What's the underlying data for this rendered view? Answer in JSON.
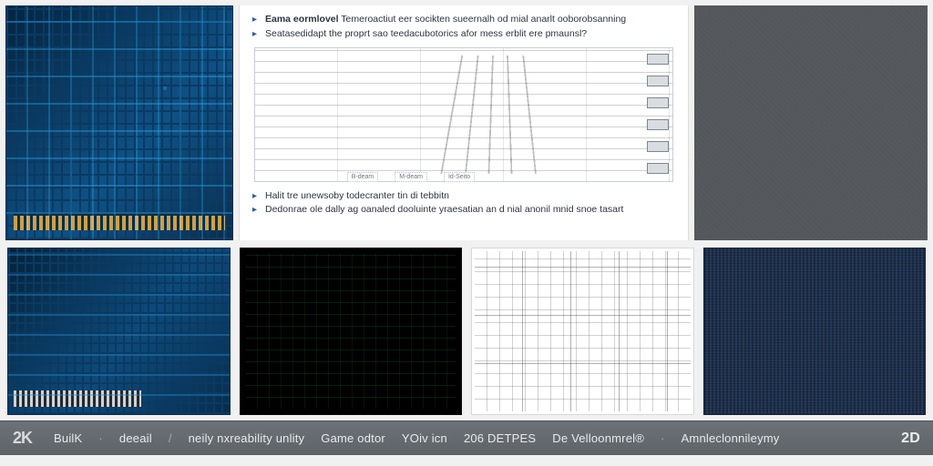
{
  "diagram": {
    "bullets_top": [
      {
        "lead": "Eama eormlovel",
        "rest": "Temeroactiut eer socikten sueernalh od mial anarlt ooborobsanning"
      },
      {
        "lead": "",
        "rest": "Seatasedidapt the proprt sao teedacubotorics afor mess erblit ere pmaunsl?"
      }
    ],
    "bullets_bottom": [
      {
        "lead": "",
        "rest": "Halit tre unewsoby todecranter tin di tebbitn"
      },
      {
        "lead": "",
        "rest": "Dedonrae ole dally ag oanaled dooluinte yraesatian an d nial anonil mnid snoe tasart"
      }
    ],
    "mini_labels": [
      "B-deam",
      "M-deam",
      "Id-Seito"
    ]
  },
  "footer": {
    "brand": "2K",
    "items": [
      "BuilK",
      "deeail",
      "neily nxreability unlity",
      "Game odtor",
      "YOiv icn",
      "206 DETPES",
      "De Velloonmrel®",
      "Amnleclonnileymy"
    ],
    "right_badge": "2D"
  }
}
